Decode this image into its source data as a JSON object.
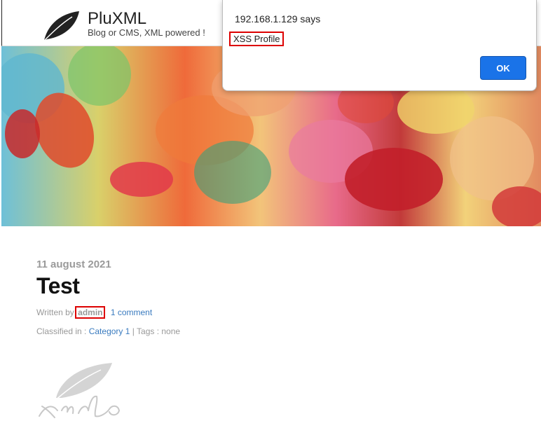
{
  "site": {
    "title": "PluXML",
    "description": "Blog or CMS, XML powered !"
  },
  "post": {
    "date": "11 august 2021",
    "title": "Test",
    "written_by_label": "Written by",
    "author": "admin",
    "comments_link": "1 comment",
    "classified_label": "Classified in :",
    "category_link": "Category 1",
    "separator": "|",
    "tags_text": "Tags : none"
  },
  "dialog": {
    "origin_says": "192.168.1.129 says",
    "message": "XSS Profile",
    "ok_label": "OK",
    "ok_color": "#1a73e8"
  },
  "colors": {
    "link": "#3a7bbf",
    "highlight_box": "#dd0000"
  },
  "icons": {
    "site_logo": "leaf-logo-icon",
    "footer_logo": "pluxml-leaf-xml-logo-icon"
  }
}
